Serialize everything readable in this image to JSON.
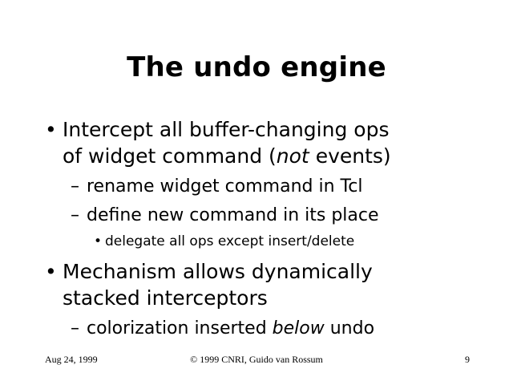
{
  "slide": {
    "title": "The undo engine",
    "bullet_1": {
      "symbol": "•",
      "line_1": "Intercept all buffer-changing ops",
      "line_2_pre": "of widget command (",
      "line_2_em": "not",
      "line_2_post": " events)",
      "sub_1": "rename widget command in Tcl",
      "sub_2": "define new command in its place",
      "subsub_1": "delegate all ops except insert/delete"
    },
    "bullet_2": {
      "symbol": "•",
      "line_1": "Mechanism allows dynamically",
      "line_2": "stacked interceptors",
      "sub_1_pre": "colorization inserted ",
      "sub_1_em": "below",
      "sub_1_post": " undo"
    },
    "dash": "–"
  },
  "footer": {
    "date": "Aug 24, 1999",
    "copyright": "© 1999 CNRI, Guido van Rossum",
    "page_number": "9"
  }
}
